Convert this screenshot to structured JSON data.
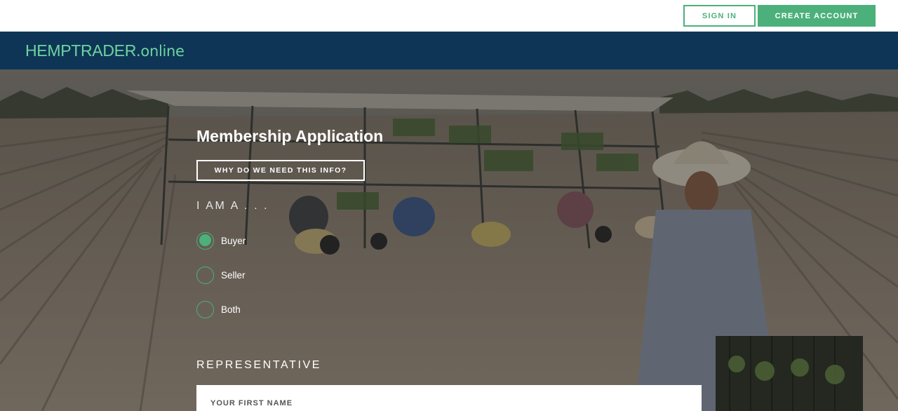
{
  "topbar": {
    "sign_in_label": "SIGN IN",
    "create_account_label": "CREATE ACCOUNT"
  },
  "brand": {
    "logo_main": "HEMPTRADER",
    "logo_tld": ".online"
  },
  "form": {
    "title": "Membership Application",
    "why_button_label": "WHY DO WE NEED THIS INFO?",
    "i_am_label": "I AM A . . .",
    "role_options": [
      {
        "label": "Buyer",
        "selected": true
      },
      {
        "label": "Seller",
        "selected": false
      },
      {
        "label": "Both",
        "selected": false
      }
    ],
    "representative_label": "REPRESENTATIVE",
    "first_name_label": "YOUR FIRST NAME"
  },
  "colors": {
    "accent": "#4cb07a",
    "navbar": "#0e3556",
    "logo": "#6fd3a0"
  }
}
